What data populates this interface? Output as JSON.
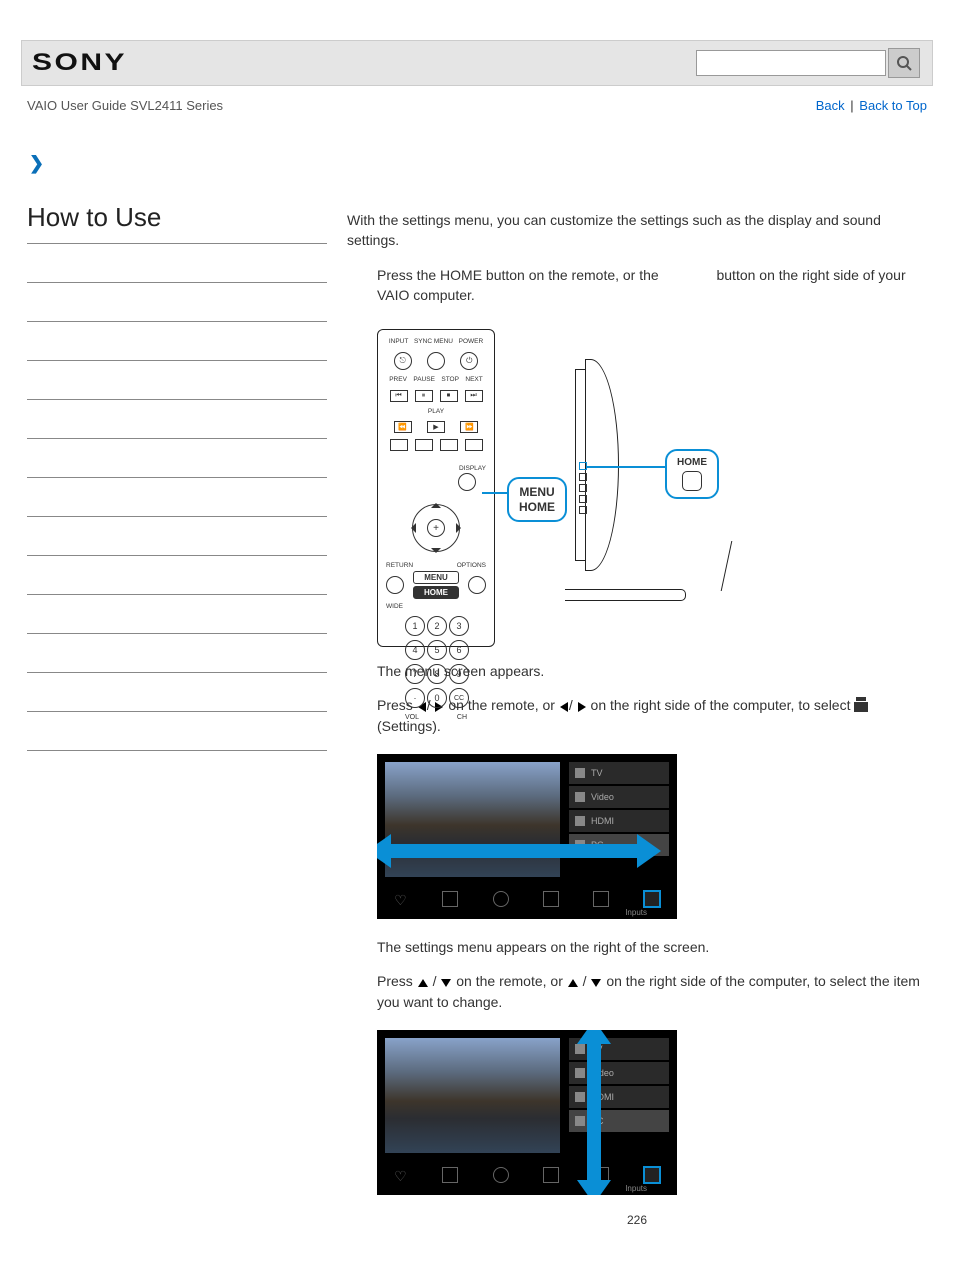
{
  "header": {
    "brand": "SONY",
    "search_placeholder": ""
  },
  "breadcrumb": {
    "guide_title": "VAIO User Guide SVL2411 Series",
    "back_label": "Back",
    "back_to_top_label": "Back to Top",
    "separator": "|"
  },
  "sidebar": {
    "heading": "How to Use"
  },
  "content": {
    "intro": "With the settings menu, you can customize the settings such as the display and sound settings.",
    "step1_a": "Press the HOME button on the remote, or the ",
    "step1_b": " button on the right side of your VAIO computer.",
    "diagram": {
      "remote": {
        "top_labels": [
          "INPUT",
          "SYNC MENU",
          "POWER"
        ],
        "row2_labels": [
          "PREV",
          "PAUSE",
          "STOP",
          "NEXT"
        ],
        "play_label": "PLAY",
        "display_label": "DISPLAY",
        "return_label": "RETURN",
        "options_label": "OPTIONS",
        "menu_label": "MENU",
        "home_label": "HOME",
        "wide_label": "WIDE",
        "cc_label": "CC",
        "numbers": [
          "1",
          "2",
          "3",
          "4",
          "5",
          "6",
          "7",
          "8",
          "9",
          "·",
          "0"
        ],
        "vol_label": "VOL",
        "ch_label": "CH"
      },
      "remote_callout": "MENU\nHOME",
      "monitor_callout": "HOME"
    },
    "step1_after": "The menu screen appears.",
    "step2_a": "Press ",
    "step2_mid": " on the remote, or ",
    "step2_b": " on the right side of the computer, to select ",
    "step2_end": " (Settings).",
    "menu_items": [
      "TV",
      "Video",
      "HDMI",
      "PC"
    ],
    "menu_bottom_tooltip": "Inputs",
    "step2_after": "The settings menu appears on the right of the screen.",
    "step3_a": "Press ",
    "step3_mid": " on the remote, or ",
    "step3_b": " on the right side of the computer, to select the item you want to change."
  },
  "page_number": "226"
}
